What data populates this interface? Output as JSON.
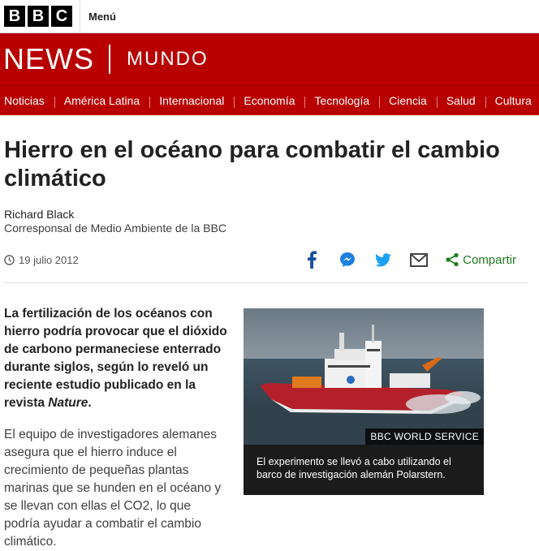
{
  "brand": {
    "bbc_letters": [
      "B",
      "B",
      "C"
    ],
    "menu_label": "Menú",
    "news": "NEWS",
    "mundo": "MUNDO",
    "accent_color": "#b80000"
  },
  "nav": {
    "items": [
      "Noticias",
      "América Latina",
      "Internacional",
      "Economía",
      "Tecnología",
      "Ciencia",
      "Salud",
      "Cultura"
    ]
  },
  "article": {
    "title": "Hierro en el océano para combatir el cambio climático",
    "author": "Richard Black",
    "role": "Corresponsal de Medio Ambiente de la BBC",
    "date": "19 julio 2012",
    "lead_main": "La fertilización de los océanos con hierro podría provocar que el dióxido de carbono permaneciese enterrado durante siglos, según lo reveló un reciente estudio publicado en la revista ",
    "lead_italic": "Nature",
    "lead_end": ".",
    "paragraph": "El equipo de investigadores alemanes asegura que el hierro induce el crecimiento de pequeñas plantas marinas que se hunden en el océano y se llevan con ellas el CO2, lo que podría ayudar a combatir el cambio climático."
  },
  "share": {
    "icons": [
      "facebook-icon",
      "messenger-icon",
      "twitter-icon",
      "email-icon",
      "share-icon"
    ],
    "label": "Compartir"
  },
  "figure": {
    "credit": "BBC WORLD SERVICE",
    "caption": "El experimento se llevó a cabo utilizando el barco de investigación alemán Polarstern."
  }
}
